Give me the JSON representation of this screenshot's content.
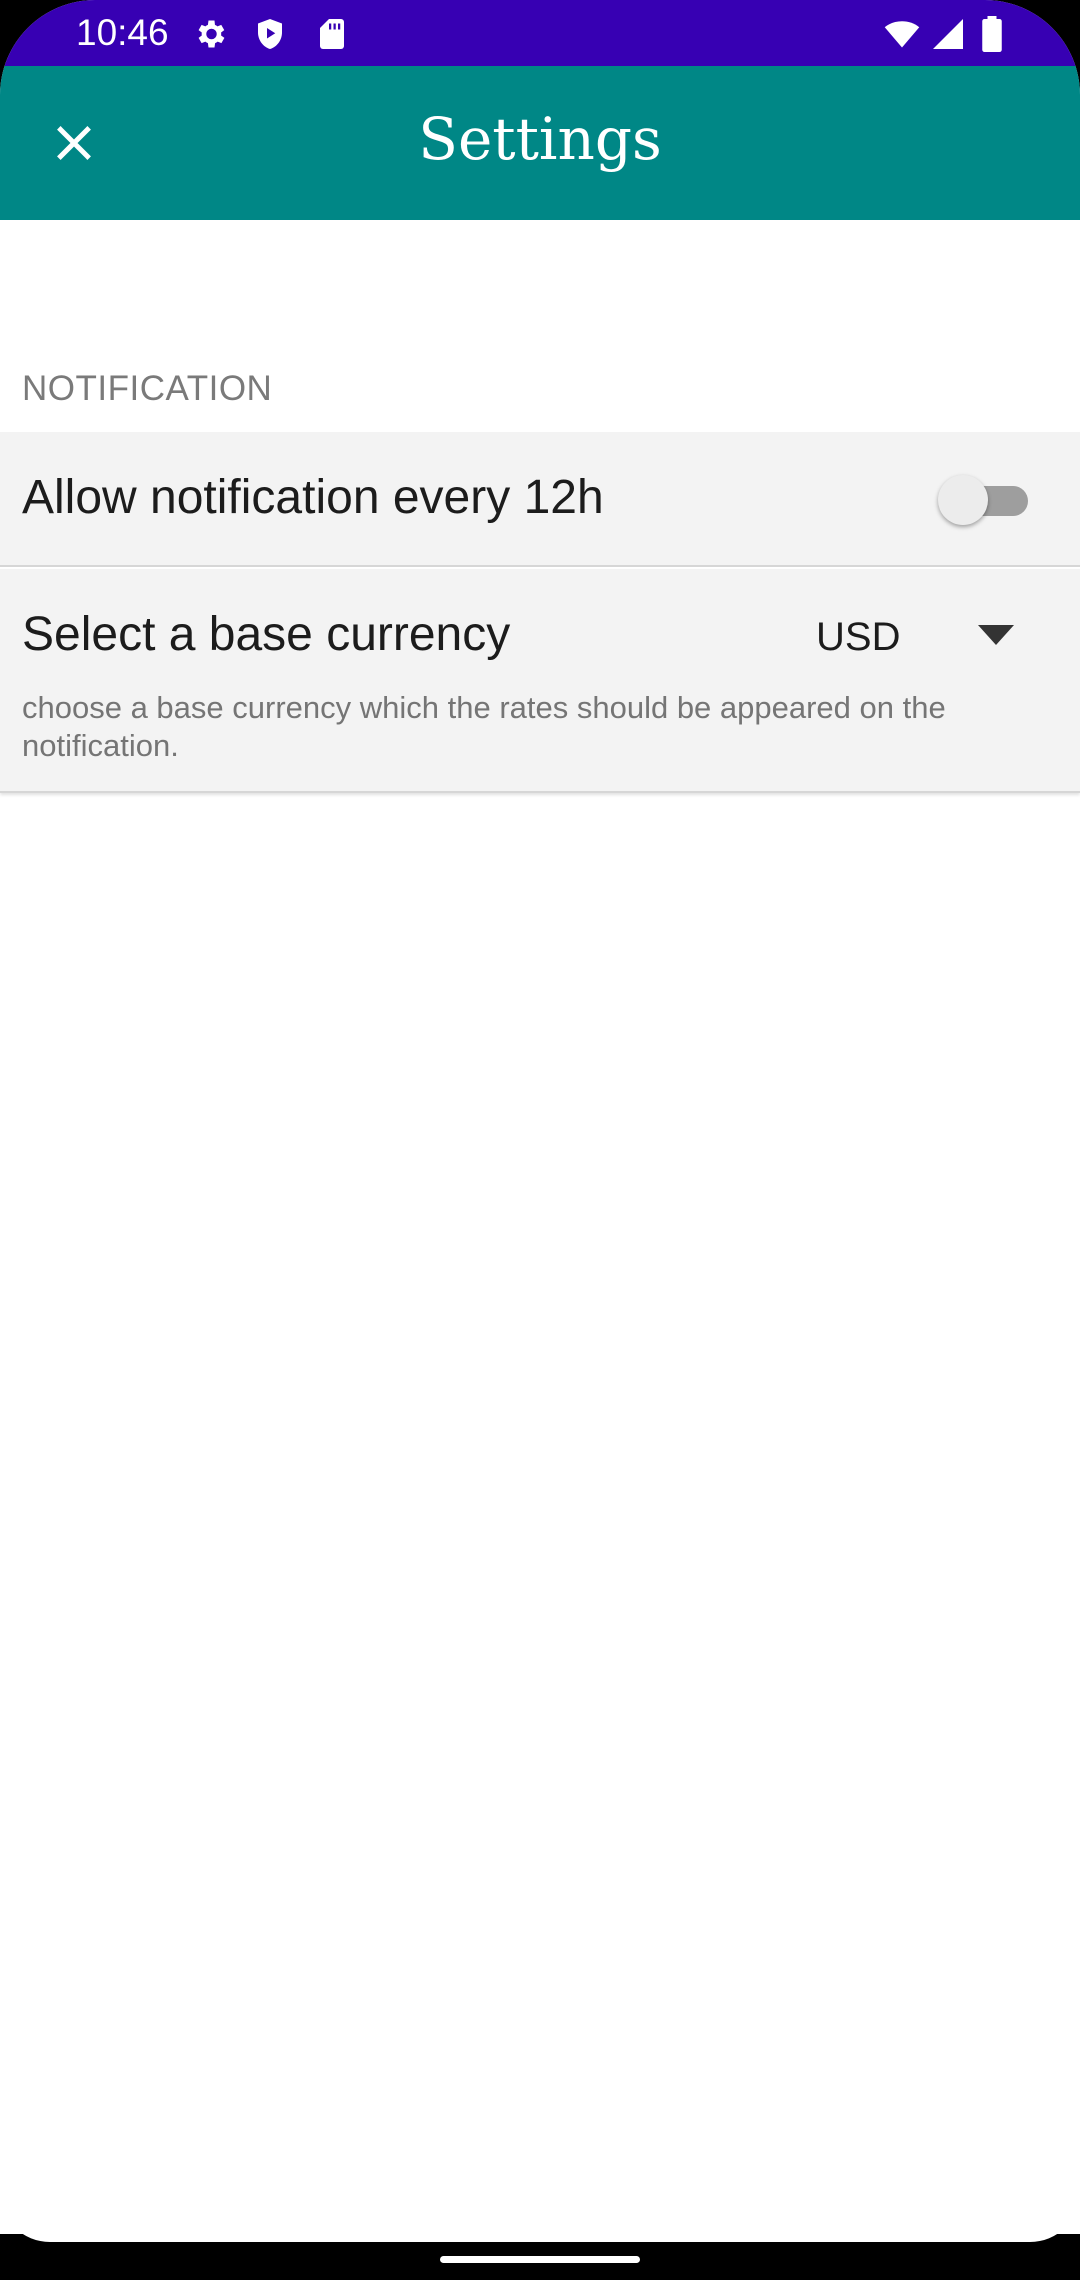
{
  "status_bar": {
    "time": "10:46",
    "icons_left": [
      "gear-icon",
      "shield-play-icon",
      "sd-card-icon"
    ],
    "icons_right": [
      "wifi-icon",
      "signal-icon",
      "battery-icon"
    ]
  },
  "app_bar": {
    "title": "Settings",
    "close_icon": "close-icon",
    "background_color": "#008786"
  },
  "notification_section": {
    "header": "NOTIFICATION",
    "allow_notification": {
      "title": "Allow notification every 12h",
      "enabled": false
    },
    "base_currency": {
      "title": "Select a base currency",
      "selected_value": "USD",
      "summary": "choose a base currency which the rates should be appeared on the notification."
    }
  },
  "colors": {
    "status_bar": "#3700b3",
    "app_bar": "#008786",
    "row_background": "#f3f3f3",
    "section_header": "#7a7a7a"
  }
}
